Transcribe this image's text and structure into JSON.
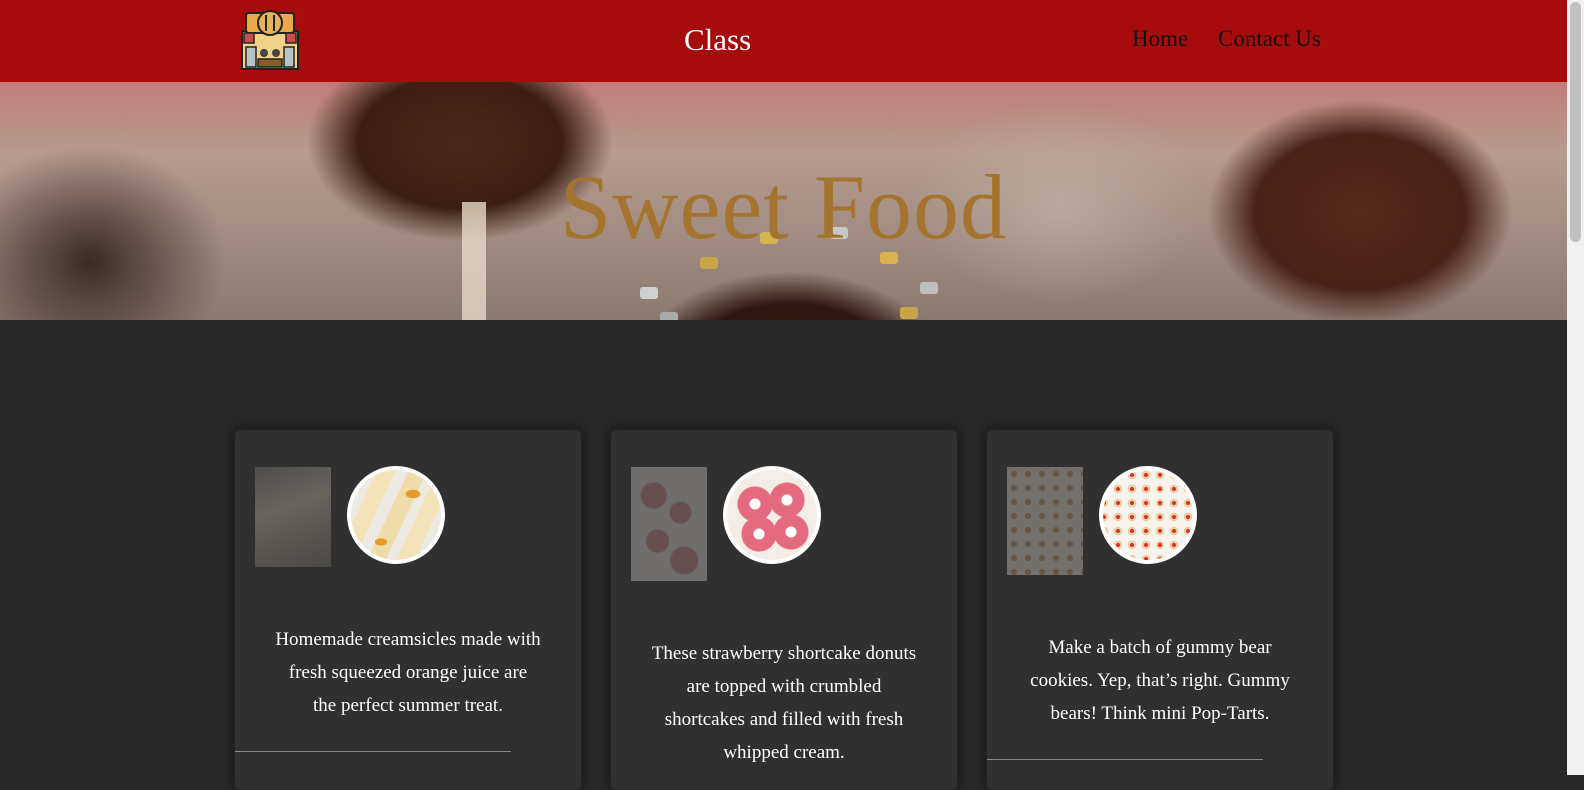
{
  "header": {
    "title": "Class",
    "nav": {
      "home": "Home",
      "contact": "Contact Us"
    },
    "logo_icon": "restaurant-storefront-icon",
    "background_color": "#a60c0c"
  },
  "hero": {
    "title": "Sweet Food",
    "title_color": "#a4742f"
  },
  "cards": [
    {
      "description": "Homemade creamsicles made with fresh squeezed orange juice are the perfect summer treat.",
      "image": "creamsicles-photo"
    },
    {
      "description": "These strawberry shortcake donuts are topped with crumbled shortcakes and filled with fresh whipped cream.",
      "image": "strawberry-donuts-photo"
    },
    {
      "description": "Make a batch of gummy bear cookies. Yep, that’s right. Gummy bears! Think mini Pop-Tarts.",
      "image": "gummy-bear-cookies-photo"
    }
  ]
}
